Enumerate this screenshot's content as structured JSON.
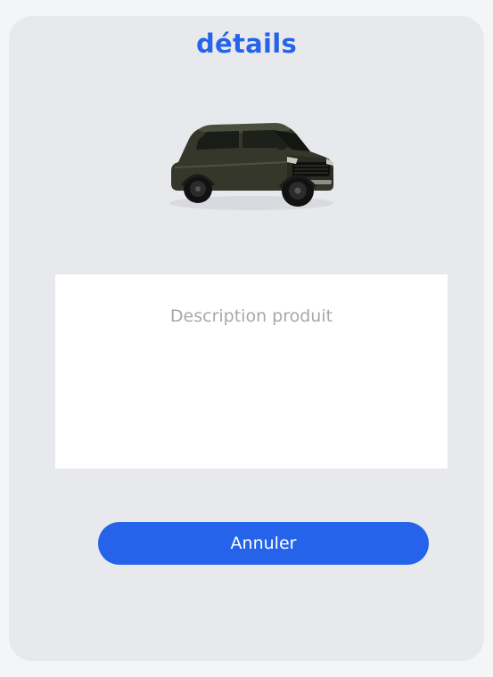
{
  "card": {
    "title": "détails",
    "image": {
      "icon": "car-suv-icon"
    },
    "description": {
      "placeholder": "Description produit"
    },
    "cancel_label": "Annuler"
  },
  "colors": {
    "accent": "#2563eb",
    "card_background": "#e8e9ed",
    "page_background": "#f4f5f7",
    "description_background": "#ffffff",
    "placeholder_text": "#a6a8ad"
  }
}
